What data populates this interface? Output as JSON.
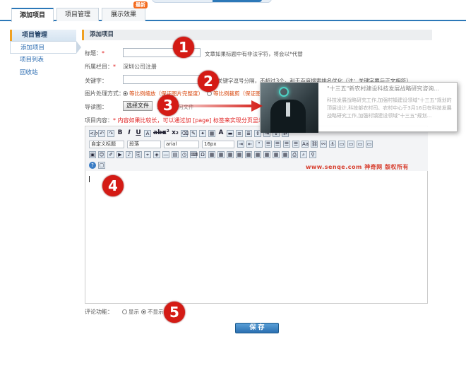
{
  "tabs": [
    {
      "label": "添加项目"
    },
    {
      "label": "项目管理"
    },
    {
      "label": "展示效果",
      "badge": "最新"
    }
  ],
  "sidebar": {
    "title": "项目管理",
    "items": [
      {
        "label": "添加项目"
      },
      {
        "label": "项目列表"
      },
      {
        "label": "回收站"
      }
    ]
  },
  "section_title": "添加项目",
  "form": {
    "title_label": "标题：",
    "title_note": "文章如果标题中有非法字符，将会以*代替",
    "column_label": "所属栏目：",
    "column_value": "深圳公司注册",
    "keyword_label": "关键字：",
    "keyword_note": "关键字逗号分隔，不超过3个，利于百度搜索排名优化（注：关键字要与正文相符）",
    "image_label": "图片处理方式：",
    "image_opt1": "等比例缩放（保证图片完整度）",
    "image_opt2": "等比例裁剪（保证图",
    "guide_label": "导读图：",
    "choose_file": "选择文件",
    "no_file": "未选择任何文件",
    "content_label": "项目内容：",
    "content_note": "* 内容如果比较长，可以通过加 [page] 标签来实现分页显示！",
    "comment_label": "评论功能：",
    "comment_show": "显示",
    "comment_hide": "不显示",
    "save": "保 存"
  },
  "popup": {
    "title": "\"十三五\"新农村建设科技发展战略研究咨询...",
    "text": "科技发展战略研究工作,加强村镇建设领域\"十三五\"规划的顶层设计,科技部农村司、农村中心于3月16日在科技发展战略研究工作,加强村镇建设领域\"十三五\"规划..."
  },
  "editor": {
    "format_select": "自定义标题",
    "para_select": "段落",
    "font_select": "arial",
    "size_select": "16px",
    "watermark": "www.senqe.com  神奇网  版权所有"
  },
  "markers": [
    "1",
    "2",
    "3",
    "4",
    "5"
  ],
  "colors": {
    "accent": "#2c78b8",
    "marker": "#d41b15",
    "warning": "#e02020"
  }
}
